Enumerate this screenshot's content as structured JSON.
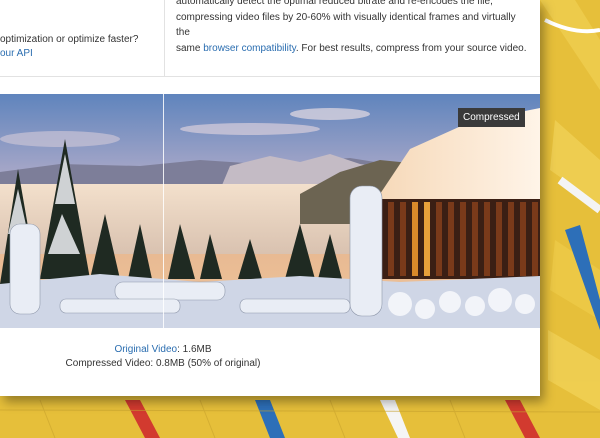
{
  "left_panel": {
    "question": "optimization or optimize faster?",
    "api_link": "our API"
  },
  "description": {
    "line1": "automatically detect the optimal reduced bitrate and re-encodes the file,",
    "line2": "compressing video files by 20-60% with visually identical frames and virtually the",
    "line3_prefix": "same ",
    "compat_link": "browser compatibility",
    "line3_suffix": ". For best results, compress from your source video."
  },
  "compare": {
    "badge": "Compressed"
  },
  "captions": {
    "original_link": "Original Video",
    "original_size": ": 1.6MB",
    "compressed": "Compressed Video: 0.8MB (50% of original)"
  },
  "colors": {
    "link": "#2a6db0",
    "badge_bg": "#3a3a3a",
    "desk_yellow": "#e9c33c",
    "stripe_red": "#d23a2f",
    "stripe_blue": "#2d6fb8"
  }
}
